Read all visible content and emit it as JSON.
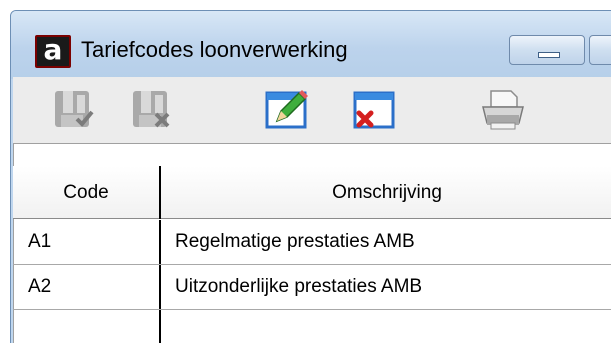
{
  "window": {
    "title": "Tariefcodes loonverwerking",
    "app_icon_letter": "a"
  },
  "toolbar": {
    "buttons": [
      {
        "name": "save-disabled",
        "icon": "save-confirm-icon"
      },
      {
        "name": "cancel-disabled",
        "icon": "save-cancel-icon"
      },
      {
        "name": "edit",
        "icon": "edit-pencil-icon"
      },
      {
        "name": "delete",
        "icon": "delete-window-icon"
      },
      {
        "name": "print",
        "icon": "printer-icon"
      }
    ]
  },
  "grid": {
    "columns": [
      "Code",
      "Omschrijving"
    ],
    "rows": [
      {
        "code": "A1",
        "omschrijving": "Regelmatige prestaties AMB"
      },
      {
        "code": "A2",
        "omschrijving": "Uitzonderlijke prestaties AMB"
      }
    ]
  },
  "colors": {
    "titlebar": "#bcd3ec",
    "toolbar": "#ececec",
    "grid_bg": "#ffffff"
  }
}
